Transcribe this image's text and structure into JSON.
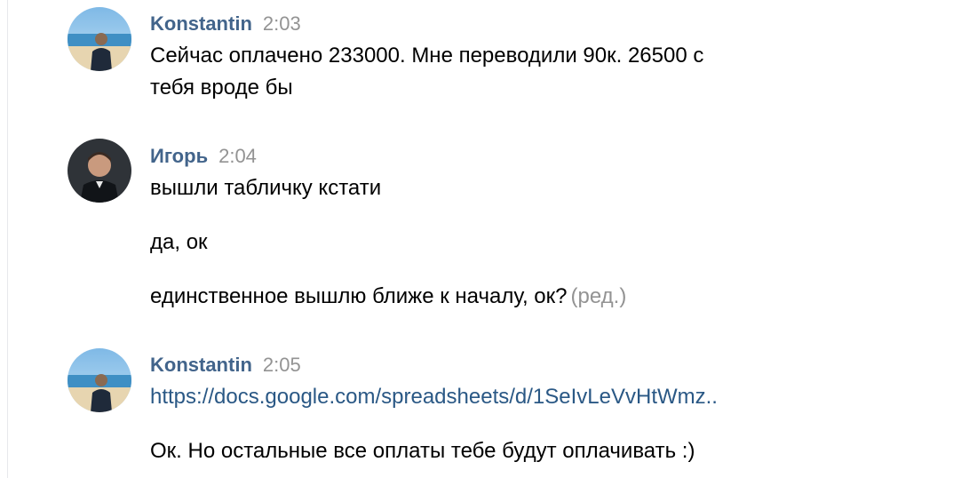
{
  "messages": [
    {
      "author": "Konstantin",
      "time": "2:03",
      "avatar": "avatar-beach-icon",
      "lines": [
        "Сейчас оплачено 233000. Мне переводили 90к. 26500 с",
        "тебя вроде бы"
      ]
    },
    {
      "author": "Игорь",
      "time": "2:04",
      "avatar": "avatar-portrait-icon",
      "texts": [
        "вышли табличку кстати",
        "да, ок",
        "единственное вышлю ближе к началу, ок?"
      ],
      "edited": "(ред.)"
    },
    {
      "author": "Konstantin",
      "time": "2:05",
      "avatar": "avatar-beach-icon",
      "link": "https://docs.google.com/spreadsheets/d/1SeIvLeVvHtWmz..",
      "text": "Ок. Но остальные все оплаты тебе будут оплачивать :)"
    }
  ],
  "colors": {
    "author": "#42648b",
    "time": "#939393",
    "link": "#2a5885",
    "text": "#000000"
  }
}
